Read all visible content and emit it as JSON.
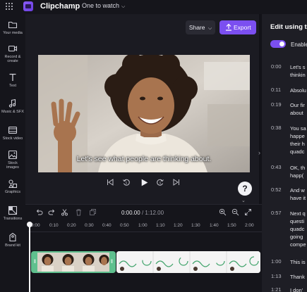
{
  "app": {
    "name": "Clipchamp",
    "project_title": "One to watch"
  },
  "rail": [
    {
      "icon": "folder-icon",
      "label_lines": [
        "Your media"
      ]
    },
    {
      "icon": "camera-icon",
      "label_lines": [
        "Record &",
        "create"
      ]
    },
    {
      "icon": "text-icon",
      "label_lines": [
        "Text"
      ]
    },
    {
      "icon": "music-note-icon",
      "label_lines": [
        "Music & SFX"
      ]
    },
    {
      "icon": "film-icon",
      "label_lines": [
        "Stock video"
      ]
    },
    {
      "icon": "image-icon",
      "label_lines": [
        "Stock",
        "images"
      ]
    },
    {
      "icon": "shapes-icon",
      "label_lines": [
        "Graphics"
      ]
    },
    {
      "icon": "transitions-icon",
      "label_lines": [
        "Transitions"
      ]
    },
    {
      "icon": "brand-kit-icon",
      "label_lines": [
        "Brand kit"
      ]
    }
  ],
  "header": {
    "share_label": "Share",
    "export_label": "Export"
  },
  "preview": {
    "caption": "Let's see what people are thinking about.",
    "help_label": "?"
  },
  "timeline": {
    "current_time": "0:00.00",
    "total_time": "1:12.00",
    "ruler": [
      "0:00",
      "0:10",
      "0:20",
      "0:30",
      "0:40",
      "0:50",
      "1:00",
      "1:10",
      "1:20",
      "1:30",
      "1:40",
      "1:50",
      "2:00"
    ]
  },
  "transcript": {
    "title": "Edit using tra",
    "toggle_label": "Enable",
    "rows": [
      {
        "time": "0:00",
        "lines": [
          "Let's s",
          "thinkin"
        ]
      },
      {
        "time": "0:11",
        "lines": [
          "Absolu"
        ]
      },
      {
        "time": "0:19",
        "lines": [
          "Our fir",
          "about"
        ]
      },
      {
        "time": "0:38",
        "lines": [
          "You sa",
          "happe",
          "their h",
          "quadc"
        ]
      },
      {
        "time": "0:43",
        "lines": [
          "OK, th",
          "happ("
        ]
      },
      {
        "time": "0:52",
        "lines": [
          "And w",
          "have it"
        ]
      },
      {
        "time": "0:57",
        "lines": [
          "Next q",
          "questi",
          "quadc",
          "going",
          "compe"
        ]
      },
      {
        "time": "1:00",
        "lines": [
          "This is"
        ]
      },
      {
        "time": "1:13",
        "lines": [
          "Thank"
        ]
      },
      {
        "time": "1:21",
        "lines": [
          "I don'"
        ]
      }
    ]
  },
  "colors": {
    "accent": "#7b4ff0",
    "clip_green": "#5fc08e",
    "background": "#121218"
  }
}
